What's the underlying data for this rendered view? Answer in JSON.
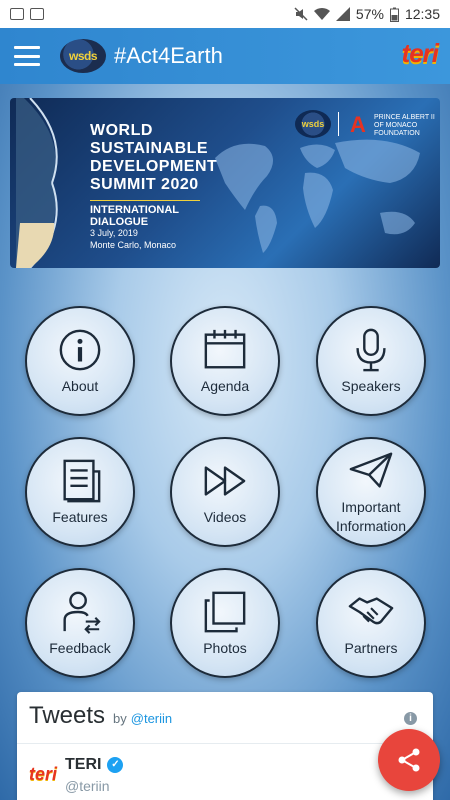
{
  "status_bar": {
    "battery": "57%",
    "time": "12:35"
  },
  "app_bar": {
    "title": "#Act4Earth",
    "logo_text": "wsds",
    "partner_logo_text": "teri"
  },
  "banner": {
    "title": "WORLD SUSTAINABLE DEVELOPMENT SUMMIT 2020",
    "subtitle": "INTERNATIONAL DIALOGUE",
    "date": "3 July, 2019",
    "place": "Monte Carlo, Monaco",
    "logo_text": "wsds",
    "partner": "PRINCE ALBERT II OF MONACO FOUNDATION"
  },
  "menu": [
    {
      "label": "About",
      "icon": "info-icon"
    },
    {
      "label": "Agenda",
      "icon": "calendar-icon"
    },
    {
      "label": "Speakers",
      "icon": "microphone-icon"
    },
    {
      "label": "Features",
      "icon": "document-icon"
    },
    {
      "label": "Videos",
      "icon": "fast-forward-icon"
    },
    {
      "label": "Important Information",
      "icon": "paper-plane-icon"
    },
    {
      "label": "Feedback",
      "icon": "person-feedback-icon"
    },
    {
      "label": "Photos",
      "icon": "photos-icon"
    },
    {
      "label": "Partners",
      "icon": "handshake-icon"
    }
  ],
  "tweets": {
    "title": "Tweets",
    "by": "by",
    "handle": "@teriin",
    "tweet": {
      "logo": "teri",
      "name": "TERI",
      "handle": "@teriin"
    }
  },
  "colors": {
    "app_bar": "#2f86cf",
    "fab": "#e8453c",
    "teri_red": "#e63322"
  }
}
